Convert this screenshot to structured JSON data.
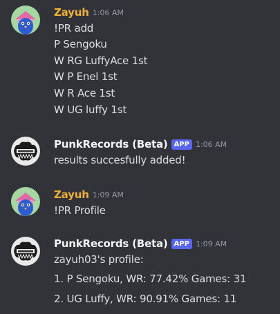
{
  "messages": [
    {
      "username": "Zayuh",
      "time": "1:06 AM",
      "lines": [
        "!PR add",
        "P Sengoku",
        "W RG LuffyAce 1st",
        "W P Enel 1st",
        "W R Ace 1st",
        "W UG luffy 1st"
      ]
    },
    {
      "username": "PunkRecords (Beta)",
      "badge": "APP",
      "time": "1:06 AM",
      "lines": [
        "results succesfully added!"
      ]
    },
    {
      "username": "Zayuh",
      "time": "1:09 AM",
      "lines": [
        "!PR Profile"
      ]
    },
    {
      "username": "PunkRecords (Beta)",
      "badge": "APP",
      "time": "1:09 AM",
      "lines": [
        "zayuh03's profile:",
        "1. P Sengoku, WR: 77.42% Games: 31",
        "2. UG Luffy, WR: 90.91% Games: 11"
      ]
    }
  ],
  "colors": {
    "background": "#313338",
    "username_user": "#f0b232",
    "username_bot": "#f2f3f5",
    "badge": "#5865f2",
    "timestamp": "#949ba4",
    "text": "#dbdee1"
  },
  "icons": {
    "user_avatar": "pink-house-blue-bird-avatar",
    "bot_avatar": "punk-records-logo-avatar"
  }
}
